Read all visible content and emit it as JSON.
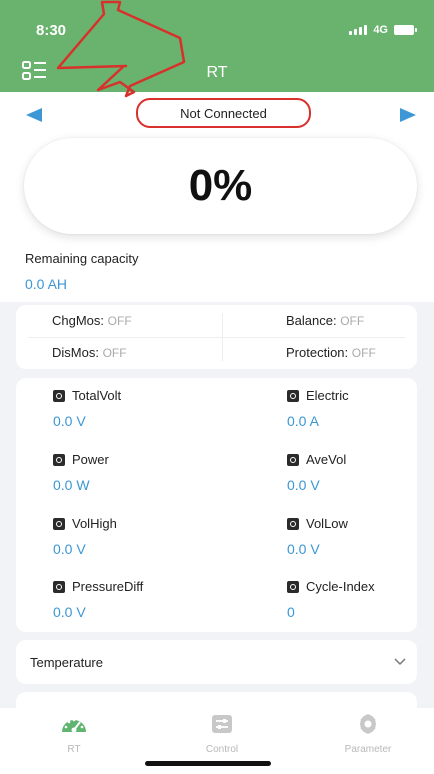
{
  "status_bar": {
    "time": "8:30",
    "network": "4G"
  },
  "header": {
    "title": "RT",
    "menu_icon": "list-menu-icon"
  },
  "connection": {
    "status": "Not Connected",
    "prev_icon": "arrow-left-icon",
    "next_icon": "arrow-right-icon"
  },
  "battery_display": {
    "percent": "0%"
  },
  "remaining": {
    "label": "Remaining capacity",
    "value": "0.0 AH"
  },
  "mos": {
    "chg": {
      "label": "ChgMos:",
      "value": "OFF"
    },
    "balance": {
      "label": "Balance:",
      "value": "OFF"
    },
    "dis": {
      "label": "DisMos:",
      "value": "OFF"
    },
    "protection": {
      "label": "Protection:",
      "value": "OFF"
    }
  },
  "metrics": {
    "total_volt": {
      "label": "TotalVolt",
      "value": "0.0 V"
    },
    "electric": {
      "label": "Electric",
      "value": "0.0 A"
    },
    "power": {
      "label": "Power",
      "value": "0.0 W"
    },
    "ave_vol": {
      "label": "AveVol",
      "value": "0.0 V"
    },
    "vol_high": {
      "label": "VolHigh",
      "value": "0.0 V"
    },
    "vol_low": {
      "label": "VolLow",
      "value": "0.0 V"
    },
    "pressure_diff": {
      "label": "PressureDiff",
      "value": "0.0 V"
    },
    "cycle_index": {
      "label": "Cycle-Index",
      "value": "0"
    }
  },
  "temperature": {
    "label": "Temperature"
  },
  "tabs": [
    {
      "label": "RT",
      "icon": "gauge-icon",
      "active": true
    },
    {
      "label": "Control",
      "icon": "sliders-icon",
      "active": false
    },
    {
      "label": "Parameter",
      "icon": "gear-icon",
      "active": false
    }
  ],
  "colors": {
    "header_green": "#6ab36e",
    "accent_blue": "#3c97d4",
    "annotation_red": "#d8302b",
    "tab_icon_green": "#5fb56f"
  }
}
